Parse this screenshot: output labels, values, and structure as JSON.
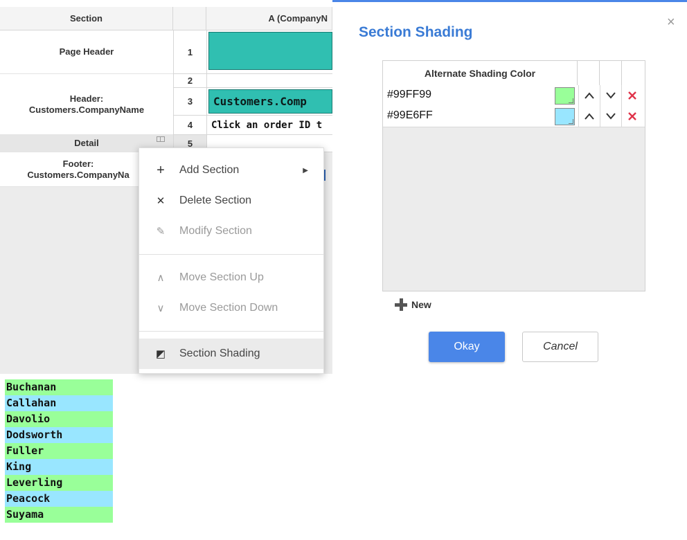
{
  "grid": {
    "header_section": "Section",
    "header_col_a": "A (CompanyN",
    "sections": [
      {
        "name": "Page Header"
      },
      {
        "name": "Header: Customers.CompanyName"
      },
      {
        "name": "Detail"
      },
      {
        "name": "Footer: Customers.CompanyNa"
      }
    ],
    "row_numbers": [
      "1",
      "2",
      "3",
      "4",
      "5"
    ],
    "cell_row3": "Customers.Comp",
    "cell_row4": "Click an order ID t"
  },
  "context_menu": {
    "items": [
      {
        "label": "Add Section",
        "icon": "plus-icon",
        "glyph": "+",
        "enabled": true,
        "submenu": true
      },
      {
        "label": "Delete Section",
        "icon": "close-icon",
        "glyph": "✕",
        "enabled": true
      },
      {
        "label": "Modify Section",
        "icon": "pencil-icon",
        "glyph": "✎",
        "enabled": false
      },
      {
        "label": "Move Section Up",
        "icon": "chevron-up-icon",
        "glyph": "∧",
        "enabled": false
      },
      {
        "label": "Move Section Down",
        "icon": "chevron-down-icon",
        "glyph": "∨",
        "enabled": false
      },
      {
        "label": "Section Shading",
        "icon": "shading-icon",
        "glyph": "◩",
        "enabled": true,
        "highlighted": true
      }
    ]
  },
  "dialog": {
    "title": "Section Shading",
    "close_glyph": "×",
    "table_header": "Alternate Shading Color",
    "rows": [
      {
        "value": "#99FF99",
        "swatch": "#99FF99"
      },
      {
        "value": "#99E6FF",
        "swatch": "#99E6FF"
      }
    ],
    "new_label": "New",
    "okay_label": "Okay",
    "cancel_label": "Cancel",
    "accent_color": "#4a86e8",
    "delete_color": "#e0344a"
  },
  "names": [
    {
      "label": "Buchanan",
      "color": "#99FF99"
    },
    {
      "label": "Callahan",
      "color": "#99E6FF"
    },
    {
      "label": "Davolio",
      "color": "#99FF99"
    },
    {
      "label": "Dodsworth",
      "color": "#99E6FF"
    },
    {
      "label": "Fuller",
      "color": "#99FF99"
    },
    {
      "label": "King",
      "color": "#99E6FF"
    },
    {
      "label": "Leverling",
      "color": "#99FF99"
    },
    {
      "label": "Peacock",
      "color": "#99E6FF"
    },
    {
      "label": "Suyama",
      "color": "#99FF99"
    }
  ]
}
